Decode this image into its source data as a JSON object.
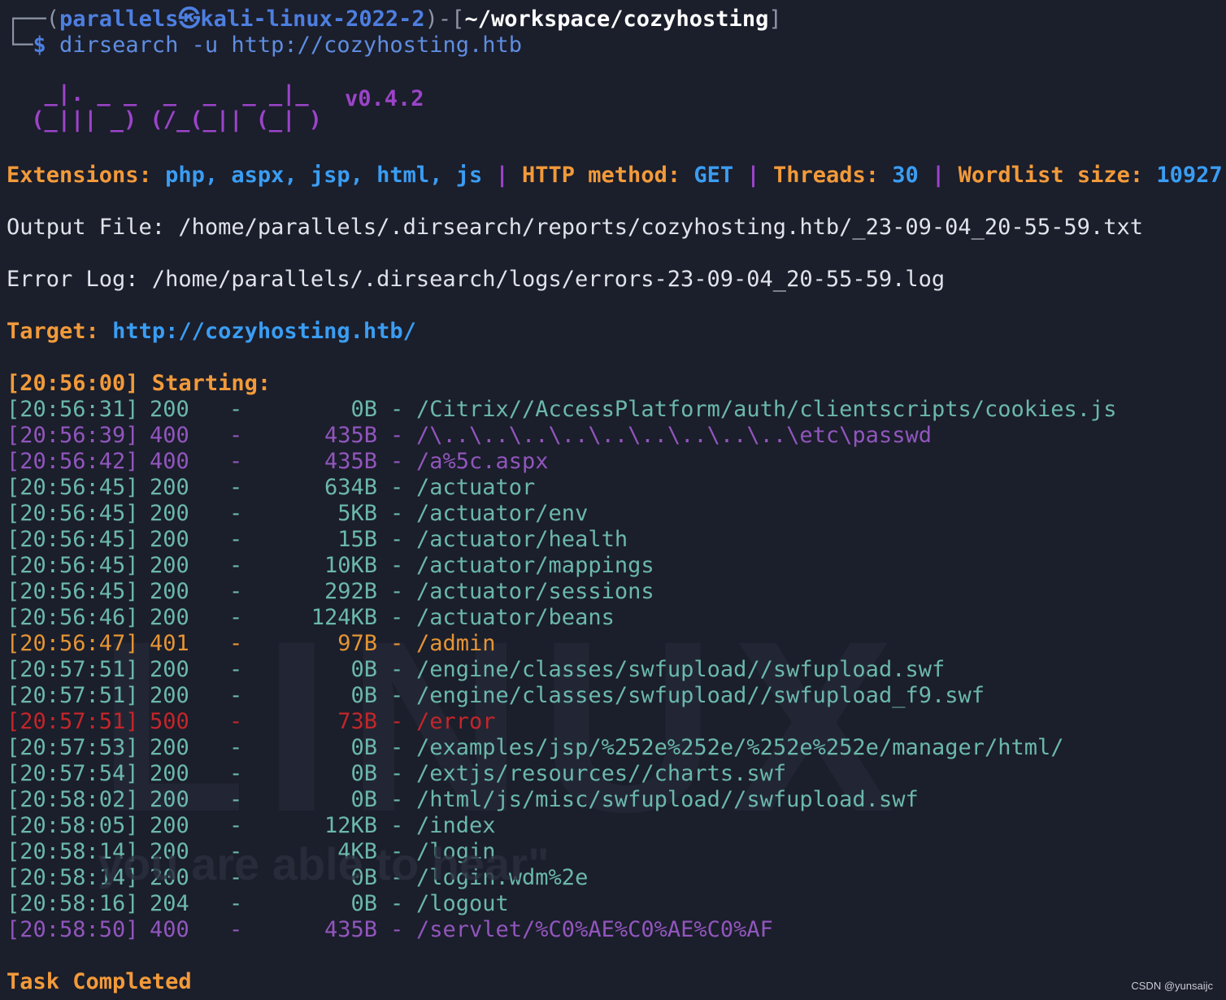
{
  "prompt": {
    "frame_top": "┌──(",
    "user_host": "parallels㉿kali-linux-2022-2",
    "mid": ")-[",
    "path": "~/workspace/cozyhosting",
    "end": "]",
    "frame_bottom": "└─",
    "dollar": "$",
    "command": "dirsearch -u http://cozyhosting.htb"
  },
  "banner": {
    "line1": "  _|. _ _  _  _  _ _|_",
    "line2": " (_||| _) (/_(_|| (_| )",
    "version": "v0.4.2"
  },
  "config": {
    "extensions_label": "Extensions:",
    "extensions": "php, aspx, jsp, html, js",
    "pipe": "|",
    "method_label": "HTTP method:",
    "method": "GET",
    "threads_label": "Threads:",
    "threads": "30",
    "wordlist_label": "Wordlist size:",
    "wordlist": "10927"
  },
  "output_file": "Output File: /home/parallels/.dirsearch/reports/cozyhosting.htb/_23-09-04_20-55-59.txt",
  "error_log": "Error Log: /home/parallels/.dirsearch/logs/errors-23-09-04_20-55-59.log",
  "target": {
    "label": "Target:",
    "url": "http://cozyhosting.htb/"
  },
  "starting": "[20:56:00] Starting:",
  "results": [
    {
      "time": "[20:56:31]",
      "status": "200",
      "size": "0B",
      "path": "/Citrix//AccessPlatform/auth/clientscripts/cookies.js",
      "color": "#6bb8ab"
    },
    {
      "time": "[20:56:39]",
      "status": "400",
      "size": "435B",
      "path": "/\\..\\..\\..\\..\\..\\..\\..\\..\\..\\etc\\passwd",
      "color": "#9156bd"
    },
    {
      "time": "[20:56:42]",
      "status": "400",
      "size": "435B",
      "path": "/a%5c.aspx",
      "color": "#9156bd"
    },
    {
      "time": "[20:56:45]",
      "status": "200",
      "size": "634B",
      "path": "/actuator",
      "color": "#6bb8ab"
    },
    {
      "time": "[20:56:45]",
      "status": "200",
      "size": "5KB",
      "path": "/actuator/env",
      "color": "#6bb8ab"
    },
    {
      "time": "[20:56:45]",
      "status": "200",
      "size": "15B",
      "path": "/actuator/health",
      "color": "#6bb8ab"
    },
    {
      "time": "[20:56:45]",
      "status": "200",
      "size": "10KB",
      "path": "/actuator/mappings",
      "color": "#6bb8ab"
    },
    {
      "time": "[20:56:45]",
      "status": "200",
      "size": "292B",
      "path": "/actuator/sessions",
      "color": "#6bb8ab"
    },
    {
      "time": "[20:56:46]",
      "status": "200",
      "size": "124KB",
      "path": "/actuator/beans",
      "color": "#6bb8ab"
    },
    {
      "time": "[20:56:47]",
      "status": "401",
      "size": "97B",
      "path": "/admin",
      "color": "#e59534"
    },
    {
      "time": "[20:57:51]",
      "status": "200",
      "size": "0B",
      "path": "/engine/classes/swfupload//swfupload.swf",
      "color": "#6bb8ab"
    },
    {
      "time": "[20:57:51]",
      "status": "200",
      "size": "0B",
      "path": "/engine/classes/swfupload//swfupload_f9.swf",
      "color": "#6bb8ab"
    },
    {
      "time": "[20:57:51]",
      "status": "500",
      "size": "73B",
      "path": "/error",
      "color": "#c3262a"
    },
    {
      "time": "[20:57:53]",
      "status": "200",
      "size": "0B",
      "path": "/examples/jsp/%252e%252e/%252e%252e/manager/html/",
      "color": "#6bb8ab"
    },
    {
      "time": "[20:57:54]",
      "status": "200",
      "size": "0B",
      "path": "/extjs/resources//charts.swf",
      "color": "#6bb8ab"
    },
    {
      "time": "[20:58:02]",
      "status": "200",
      "size": "0B",
      "path": "/html/js/misc/swfupload//swfupload.swf",
      "color": "#6bb8ab"
    },
    {
      "time": "[20:58:05]",
      "status": "200",
      "size": "12KB",
      "path": "/index",
      "color": "#6bb8ab"
    },
    {
      "time": "[20:58:14]",
      "status": "200",
      "size": "4KB",
      "path": "/login",
      "color": "#6bb8ab"
    },
    {
      "time": "[20:58:14]",
      "status": "200",
      "size": "0B",
      "path": "/login.wdm%2e",
      "color": "#6bb8ab"
    },
    {
      "time": "[20:58:16]",
      "status": "204",
      "size": "0B",
      "path": "/logout",
      "color": "#6bb8ab"
    },
    {
      "time": "[20:58:50]",
      "status": "400",
      "size": "435B",
      "path": "/servlet/%C0%AE%C0%AE%C0%AF",
      "color": "#9156bd"
    }
  ],
  "completed": "Task Completed",
  "watermark": "CSDN @yunsaijc"
}
